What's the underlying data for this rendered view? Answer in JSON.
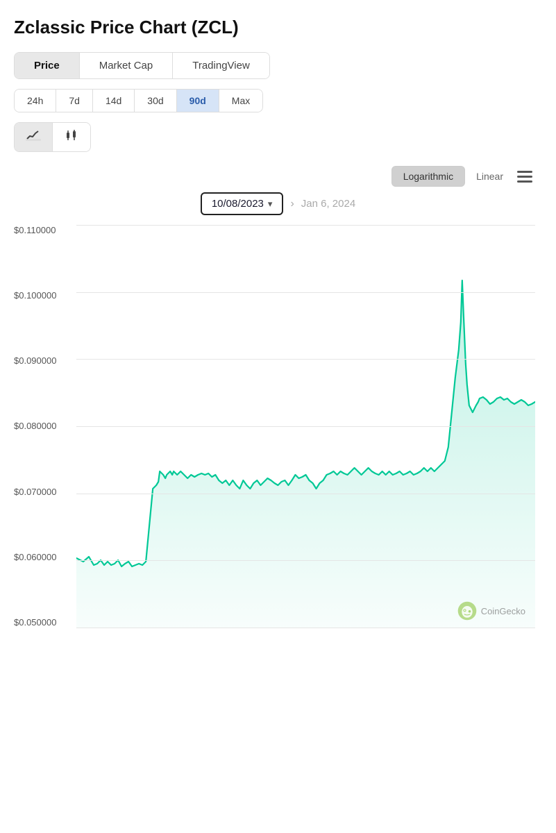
{
  "page": {
    "title": "Zclassic Price Chart (ZCL)"
  },
  "tabs": {
    "items": [
      {
        "label": "Price",
        "active": true
      },
      {
        "label": "Market Cap",
        "active": false
      },
      {
        "label": "TradingView",
        "active": false
      }
    ]
  },
  "timeframes": {
    "items": [
      {
        "label": "24h",
        "active": false
      },
      {
        "label": "7d",
        "active": false
      },
      {
        "label": "14d",
        "active": false
      },
      {
        "label": "30d",
        "active": false
      },
      {
        "label": "90d",
        "active": true
      },
      {
        "label": "Max",
        "active": false
      }
    ]
  },
  "chart_types": {
    "line": "〜",
    "candle": "🕯"
  },
  "scale": {
    "logarithmic_label": "Logarithmic",
    "linear_label": "Linear"
  },
  "date_range": {
    "start": "10/08/2023",
    "end": "Jan 6, 2024"
  },
  "y_axis": {
    "labels": [
      "$0.110000",
      "$0.100000",
      "$0.090000",
      "$0.080000",
      "$0.070000",
      "$0.060000",
      "$0.050000"
    ]
  },
  "coingecko": {
    "text": "CoinGecko"
  },
  "colors": {
    "accent": "#00c896",
    "fill": "rgba(0,200,150,0.12)",
    "active_tab_bg": "#e8e8e8",
    "active_time_bg": "#d6e4f7",
    "active_time_color": "#2a5caa"
  }
}
